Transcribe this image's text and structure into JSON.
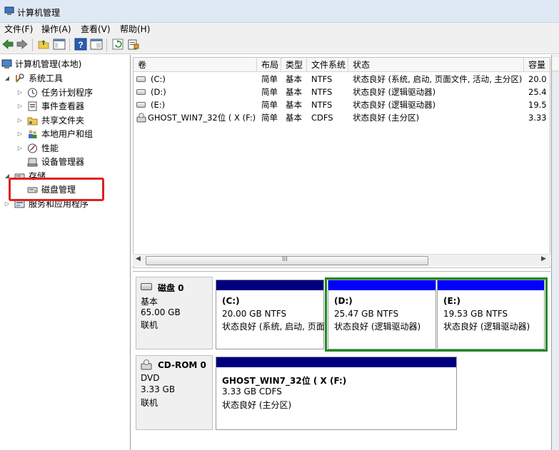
{
  "window": {
    "title": "计算机管理"
  },
  "menu": [
    "文件(F)",
    "操作(A)",
    "查看(V)",
    "帮助(H)"
  ],
  "toolbar": {
    "buttons": [
      "back-icon",
      "forward-icon",
      "up-folder-icon",
      "show-hide-tree-icon",
      "help-icon",
      "properties-icon",
      "refresh-icon",
      "export-icon"
    ]
  },
  "tree": {
    "root": "计算机管理(本地)",
    "system_tools": "系统工具",
    "task_scheduler": "任务计划程序",
    "event_viewer": "事件查看器",
    "shared_folders": "共享文件夹",
    "local_users": "本地用户和组",
    "performance": "性能",
    "device_manager": "设备管理器",
    "storage": "存储",
    "disk_management": "磁盘管理",
    "services_apps": "服务和应用程序"
  },
  "volumes": {
    "headers": [
      "卷",
      "布局",
      "类型",
      "文件系统",
      "状态",
      "容量"
    ],
    "rows": [
      [
        "(C:)",
        "简单",
        "基本",
        "NTFS",
        "状态良好 (系统, 启动, 页面文件, 活动, 主分区)",
        "20.0"
      ],
      [
        "(D:)",
        "简单",
        "基本",
        "NTFS",
        "状态良好 (逻辑驱动器)",
        "25.4"
      ],
      [
        "(E:)",
        "简单",
        "基本",
        "NTFS",
        "状态良好 (逻辑驱动器)",
        "19.5"
      ],
      [
        "GHOST_WIN7_32位 ( X (F:)",
        "简单",
        "基本",
        "CDFS",
        "状态良好 (主分区)",
        "3.33"
      ]
    ],
    "scroll_grip": "III"
  },
  "disks": {
    "disk0": {
      "name": "磁盘 0",
      "type": "基本",
      "size": "65.00 GB",
      "state": "联机",
      "partitions": [
        {
          "name": "(C:)",
          "size": "20.00 GB NTFS",
          "status": "状态良好 (系统, 启动, 页面"
        },
        {
          "name": "(D:)",
          "size": "25.47 GB NTFS",
          "status": "状态良好 (逻辑驱动器)"
        },
        {
          "name": "(E:)",
          "size": "19.53 GB NTFS",
          "status": "状态良好 (逻辑驱动器)"
        }
      ]
    },
    "cdrom0": {
      "name": "CD-ROM 0",
      "type": "DVD",
      "size": "3.33 GB",
      "state": "联机",
      "partition": {
        "name": "GHOST_WIN7_32位 ( X  (F:)",
        "size": "3.33 GB CDFS",
        "status": "状态良好 (主分区)"
      }
    }
  },
  "colors": {
    "primary_bar": "#00007f",
    "logical_bar": "#0000ff",
    "highlight_red": "#e02020",
    "highlight_green": "#1e8a1e"
  }
}
